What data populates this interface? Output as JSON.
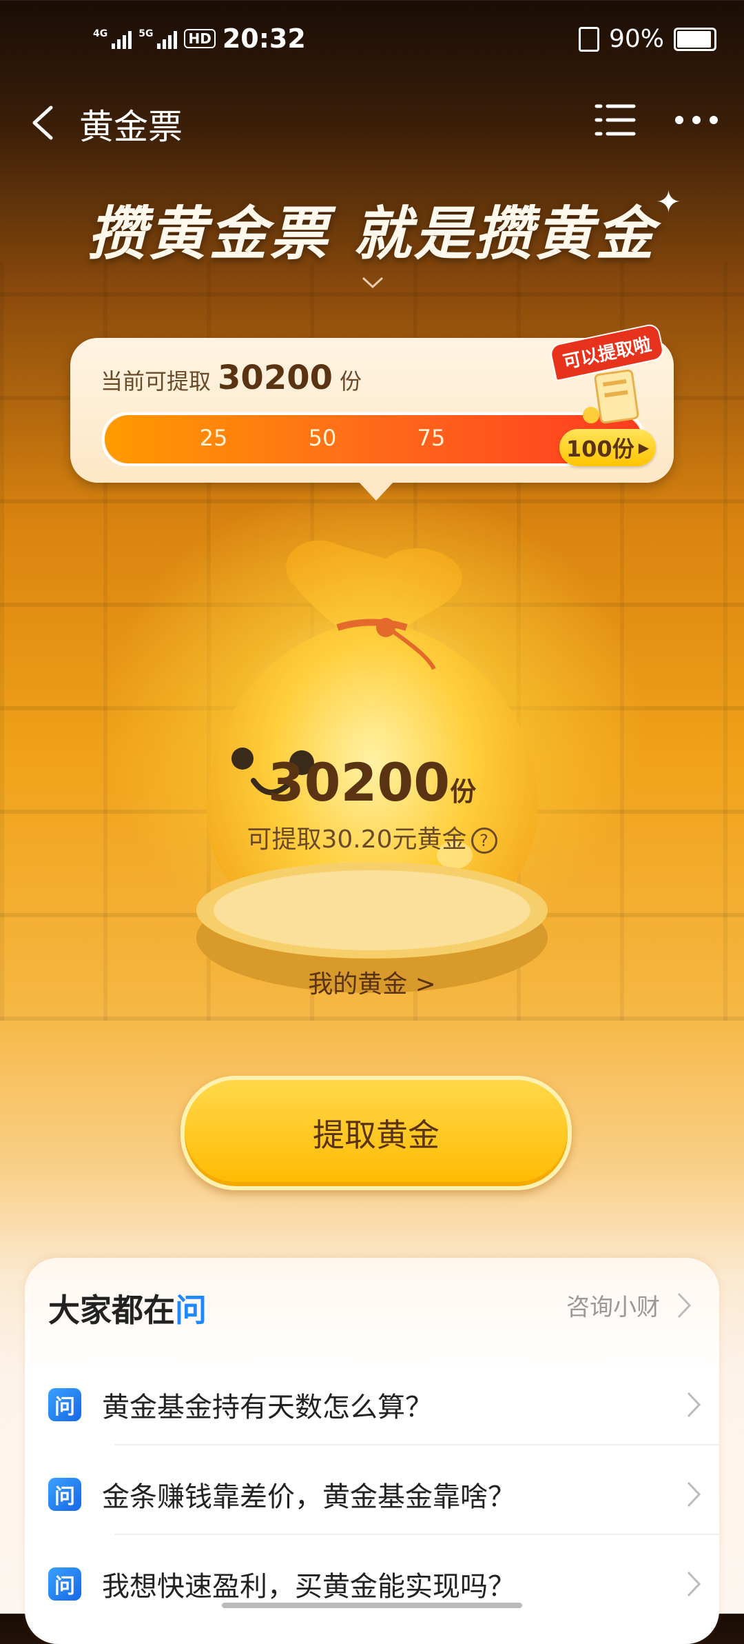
{
  "status_bar": {
    "signal1_label": "4G",
    "signal2_label": "5G",
    "hd_label": "HD",
    "time": "20:32",
    "battery": "90%"
  },
  "nav": {
    "title": "黄金票"
  },
  "hero": {
    "headline": "攒黄金票 就是攒黄金"
  },
  "progress_card": {
    "label": "当前可提取",
    "amount": "30200",
    "unit": "份",
    "ticks": [
      "25",
      "50",
      "75"
    ],
    "goal_label": "100份",
    "badge": "可以提取啦",
    "progress_fraction": 1.0
  },
  "balance": {
    "amount": "30200",
    "unit": "份",
    "subtitle": "可提取30.20元黄金",
    "help_symbol": "?",
    "my_gold_link": "我的黄金 >"
  },
  "withdraw_button": "提取黄金",
  "qa": {
    "title_main": "大家都在",
    "title_accent": "问",
    "consult_label": "咨询小财",
    "icon_glyph": "问",
    "questions": [
      "黄金基金持有天数怎么算？",
      "金条赚钱靠差价，黄金基金靠啥？",
      "我想快速盈利，买黄金能实现吗？"
    ]
  },
  "colors": {
    "accent_gold": "#ffc400",
    "progress_red": "#ff3b20",
    "qa_blue": "#1e88ff"
  }
}
